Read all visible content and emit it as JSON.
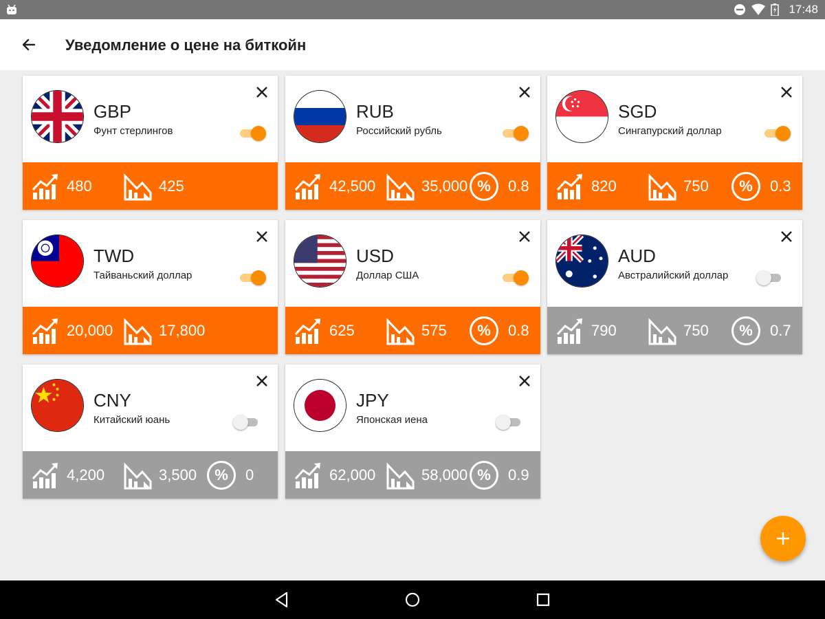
{
  "status_bar": {
    "time": "17:48"
  },
  "app_bar": {
    "title": "Уведомление о цене на биткойн"
  },
  "colors": {
    "accent": "#ff6d00",
    "inactive": "#9e9e9e",
    "fab": "#ff9800"
  },
  "cards": [
    {
      "code": "GBP",
      "name": "Фунт стерлингов",
      "enabled": true,
      "flag": "gb-flag-icon",
      "high": "480",
      "low": "425",
      "percent": ""
    },
    {
      "code": "RUB",
      "name": "Российский рубль",
      "enabled": true,
      "flag": "ru-flag-icon",
      "high": "42,500",
      "low": "35,000",
      "percent": "0.8"
    },
    {
      "code": "SGD",
      "name": "Сингапурский доллар",
      "enabled": true,
      "flag": "sg-flag-icon",
      "high": "820",
      "low": "750",
      "percent": "0.3"
    },
    {
      "code": "TWD",
      "name": "Тайваньский доллар",
      "enabled": true,
      "flag": "tw-flag-icon",
      "high": "20,000",
      "low": "17,800",
      "percent": ""
    },
    {
      "code": "USD",
      "name": "Доллар США",
      "enabled": true,
      "flag": "us-flag-icon",
      "high": "625",
      "low": "575",
      "percent": "0.8"
    },
    {
      "code": "AUD",
      "name": "Австралийский доллар",
      "enabled": false,
      "flag": "au-flag-icon",
      "high": "790",
      "low": "750",
      "percent": "0.7"
    },
    {
      "code": "CNY",
      "name": "Китайский юань",
      "enabled": false,
      "flag": "cn-flag-icon",
      "high": "4,200",
      "low": "3,500",
      "percent": "0"
    },
    {
      "code": "JPY",
      "name": "Японская иена",
      "enabled": false,
      "flag": "jp-flag-icon",
      "high": "62,000",
      "low": "58,000",
      "percent": "0.9"
    }
  ]
}
